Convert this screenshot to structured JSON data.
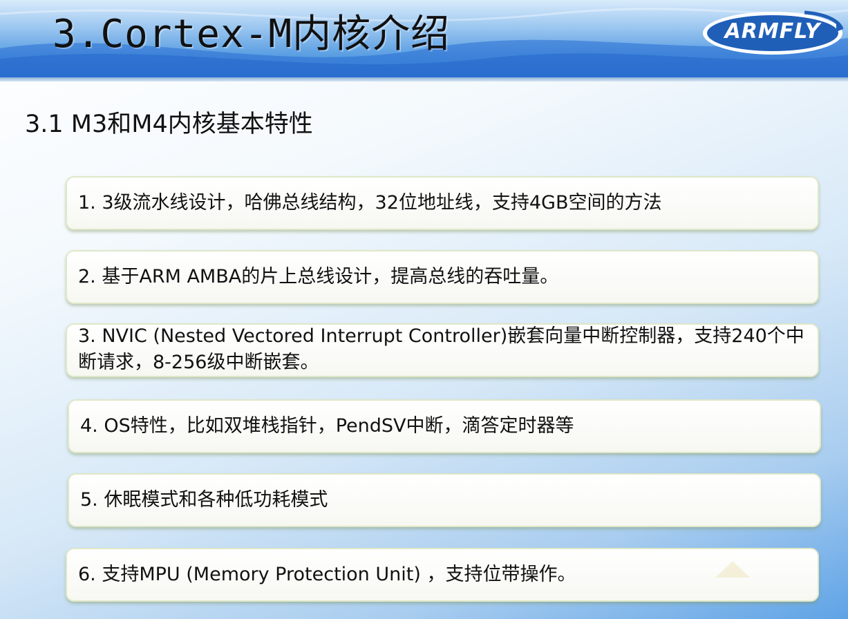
{
  "header": {
    "title": "3.Cortex-M内核介绍",
    "logo_text": "ARMFLY"
  },
  "subtitle": "3.1 M3和M4内核基本特性",
  "items": [
    {
      "text": "1. 3级流水线设计，哈佛总线结构，32位地址线，支持4GB空间的方法"
    },
    {
      "text": "2. 基于ARM AMBA的片上总线设计，提高总线的吞吐量。"
    },
    {
      "text": "3. NVIC (Nested Vectored Interrupt Controller)嵌套向量中断控制器，支持240个中断请求，8-256级中断嵌套。"
    },
    {
      "text": "4. OS特性，比如双堆栈指针，PendSV中断，滴答定时器等"
    },
    {
      "text": "5. 休眠模式和各种低功耗模式"
    },
    {
      "text": "6. 支持MPU (Memory Protection Unit) ，支持位带操作。"
    }
  ],
  "colors": {
    "header_blue": "#3f89dc",
    "logo_blue": "#1f5fb8",
    "card_border": "#dfe7c8",
    "text": "#111111"
  }
}
